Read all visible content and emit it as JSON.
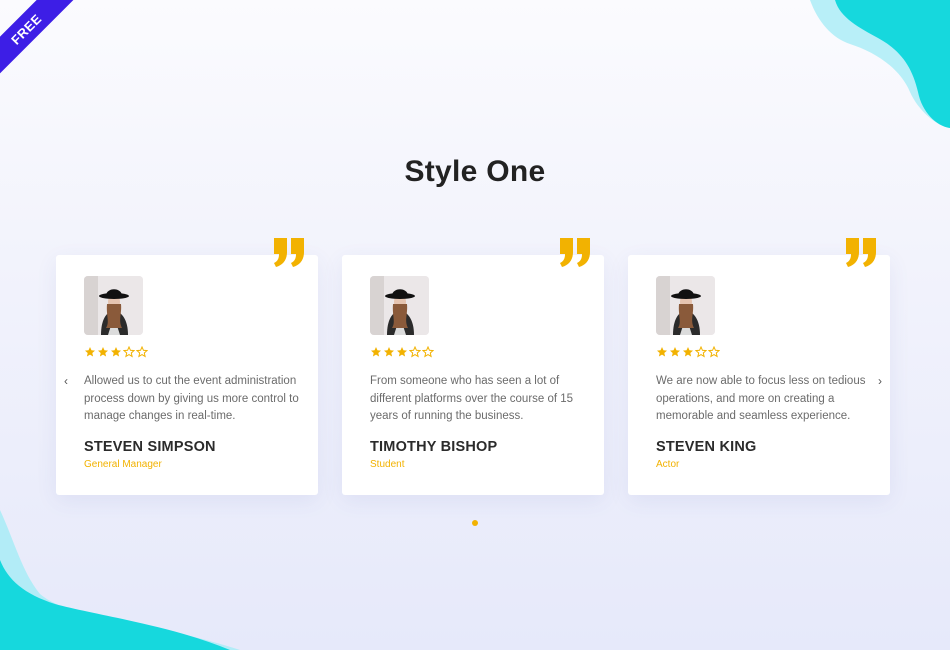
{
  "ribbon": {
    "label": "FREE",
    "color": "#3d1ee6"
  },
  "page": {
    "title": "Style One"
  },
  "colors": {
    "accent": "#f2b201",
    "blob": "#16d8dd",
    "blob_light": "#a8ecf6"
  },
  "testimonials": [
    {
      "avatar": "woman-hat-photo",
      "rating": 3,
      "max_rating": 5,
      "text": "Allowed us to cut the event administration process down by giving us more control to manage changes in real-time.",
      "name": "STEVEN SIMPSON",
      "role": "General Manager"
    },
    {
      "avatar": "woman-hat-photo",
      "rating": 3,
      "max_rating": 5,
      "text": "From someone who has seen a lot of different platforms over the course of 15 years of running the business.",
      "name": "TIMOTHY BISHOP",
      "role": "Student"
    },
    {
      "avatar": "woman-hat-photo",
      "rating": 3,
      "max_rating": 5,
      "text": "We are now able to focus less on tedious operations, and more on creating a memorable and seamless experience.",
      "name": "STEVEN KING",
      "role": "Actor"
    }
  ],
  "carousel": {
    "prev_icon": "chevron-left-icon",
    "next_icon": "chevron-right-icon",
    "prev_label": "‹",
    "next_label": "›",
    "pages": 1,
    "active_page": 1
  }
}
